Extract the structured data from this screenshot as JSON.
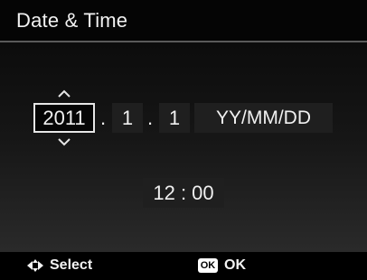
{
  "header": {
    "title": "Date & Time"
  },
  "date": {
    "year": "2011",
    "separator_1": ".",
    "month": "1",
    "separator_2": ".",
    "day": "1",
    "format": "YY/MM/DD",
    "selected_field": "year"
  },
  "time": {
    "value": "12 : 00"
  },
  "footer": {
    "select_icon": "four-way-arrows-icon",
    "select_label": "Select",
    "ok_icon_text": "OK",
    "ok_label": "OK"
  },
  "colors": {
    "background": "#0b0b0b",
    "text": "#f0f0f0",
    "selection_border": "#e6e6e6",
    "cell_background": "#1f1f1f"
  }
}
